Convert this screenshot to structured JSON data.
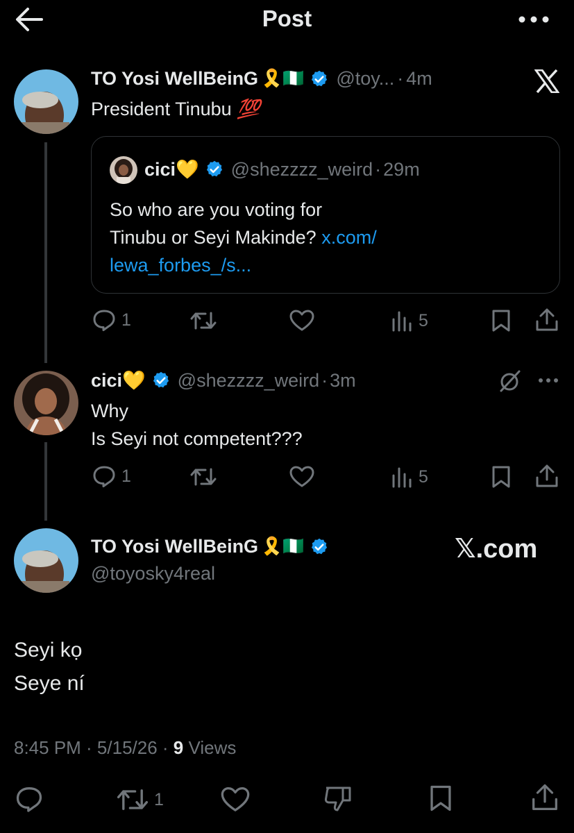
{
  "header": {
    "title": "Post"
  },
  "colors": {
    "background": "#000000",
    "text": "#e7e9ea",
    "muted": "#71767b",
    "link": "#1d9bf0",
    "verified": "#1d9bf0",
    "divider": "#2f3336"
  },
  "tweet1": {
    "name": "TO Yosi WellBeinG",
    "name_emojis": "🎗️🇳🇬",
    "handle": "@toy...",
    "separator": "·",
    "time": "4m",
    "body": "President Tinubu",
    "body_emoji": "💯",
    "quote": {
      "name": "cici",
      "name_emoji": "💛",
      "handle": "@shezzzz_weird",
      "separator": "·",
      "time": "29m",
      "line1": "So who are you voting for",
      "line2": "Tinubu or Seyi Makinde?",
      "link1": "x.com/",
      "link2": "lewa_forbes_/s..."
    },
    "actions": {
      "replies": "1",
      "views": "5"
    }
  },
  "tweet2": {
    "name": "cici",
    "name_emoji": "💛",
    "handle": "@shezzzz_weird",
    "separator": "·",
    "time": "3m",
    "line1": "Why",
    "line2": "Is Seyi not competent???",
    "actions": {
      "replies": "1",
      "views": "5"
    }
  },
  "main_tweet": {
    "name": "TO Yosi WellBeinG",
    "name_emojis": "🎗️🇳🇬",
    "handle": "@toyosky4real",
    "watermark": "𝕏.com",
    "line1": "Seyi kọ",
    "line2": "Seye ní",
    "timestamp": "8:45 PM · 5/15/26 ·",
    "views_count": "9",
    "views_label": "Views",
    "retweets": "1"
  }
}
